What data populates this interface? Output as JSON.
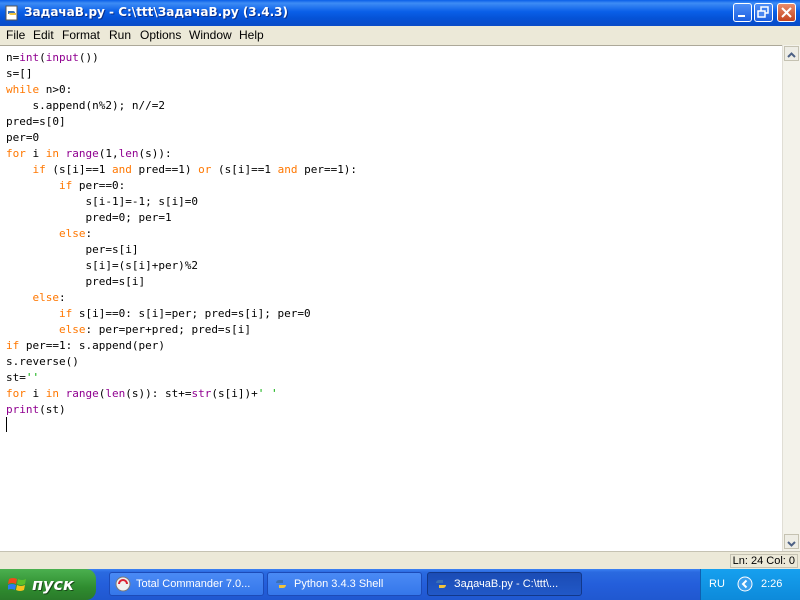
{
  "window": {
    "title": "ЗадачаВ.py - C:\\ttt\\ЗадачаВ.py (3.4.3)"
  },
  "menu": [
    "File",
    "Edit",
    "Format",
    "Run",
    "Options",
    "Window",
    "Help"
  ],
  "editor": {
    "lines": [
      "n=int(input())",
      "s=[]",
      "while n>0:",
      "    s.append(n%2); n//=2",
      "pred=s[0]",
      "per=0",
      "for i in range(1,len(s)):",
      "    if (s[i]==1 and pred==1) or (s[i]==1 and per==1):",
      "        if per==0:",
      "            s[i-1]=-1; s[i]=0",
      "            pred=0; per=1",
      "        else:",
      "            per=s[i]",
      "            s[i]=(s[i]+per)%2",
      "            pred=s[i]",
      "    else:",
      "        if s[i]==0: s[i]=per; pred=s[i]; per=0",
      "        else: per=per+pred; pred=s[i]",
      "if per==1: s.append(per)",
      "s.reverse()",
      "st=''",
      "for i in range(len(s)): st+=str(s[i])+' '",
      "print(st)"
    ]
  },
  "status": {
    "position": "Ln: 24 Col: 0"
  },
  "taskbar": {
    "start_label": "пуск",
    "tasks": [
      {
        "label": "Total Commander 7.0...",
        "icon": "total-commander-icon",
        "active": false
      },
      {
        "label": "Python 3.4.3 Shell",
        "icon": "python-icon",
        "active": false
      },
      {
        "label": "ЗадачаВ.py - C:\\ttt\\...",
        "icon": "python-icon",
        "active": true
      }
    ],
    "language": "RU",
    "clock": "2:26"
  },
  "colors": {
    "keyword": "#ff7700",
    "builtin": "#900090",
    "string": "#00aa00",
    "titlebar": "#0a5fe8",
    "taskbar": "#245edb",
    "start_button": "#3c9a3c"
  }
}
